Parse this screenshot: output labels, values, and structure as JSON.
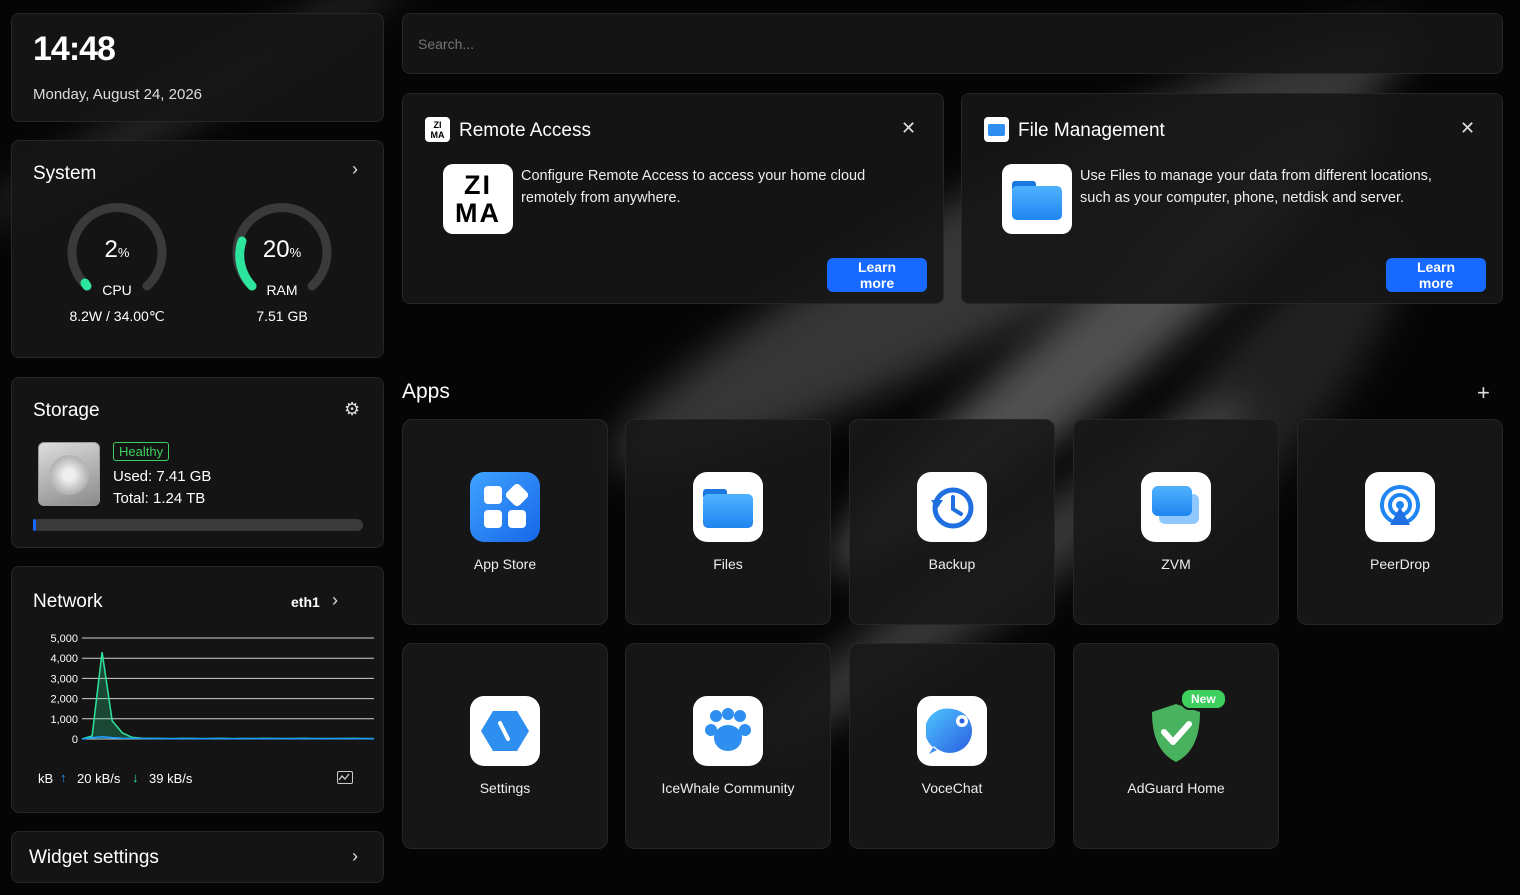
{
  "clock": {
    "time": "14:48",
    "date": "Monday, August 24, 2026"
  },
  "system": {
    "title": "System",
    "cpu": {
      "value": "2",
      "unit": "%",
      "label": "CPU",
      "detail": "8.2W / 34.00℃",
      "percent": 2
    },
    "ram": {
      "value": "20",
      "unit": "%",
      "label": "RAM",
      "detail": "7.51 GB",
      "percent": 20
    }
  },
  "storage": {
    "title": "Storage",
    "status": "Healthy",
    "used": "Used: 7.41 GB",
    "total": "Total: 1.24 TB",
    "used_fraction": 0.006
  },
  "network": {
    "title": "Network",
    "interface": "eth1",
    "unit": "kB",
    "up": "20 kB/s",
    "down": "39 kB/s",
    "chart_data": {
      "type": "area",
      "ylim": [
        0,
        5000
      ],
      "yticks": [
        "5,000",
        "4,000",
        "3,000",
        "2,000",
        "1,000",
        "0"
      ],
      "series": [
        {
          "color": "#2ee59d",
          "values": [
            0,
            150,
            4300,
            900,
            300,
            80,
            40,
            30,
            25,
            20,
            30,
            25,
            20,
            25,
            30,
            20,
            25,
            20,
            30,
            25,
            20,
            25,
            30,
            20,
            25,
            20,
            25,
            30,
            20,
            20
          ]
        },
        {
          "color": "#1e9bff",
          "values": [
            0,
            60,
            120,
            70,
            40,
            30,
            25,
            20,
            20,
            15,
            20,
            20,
            15,
            20,
            20,
            15,
            20,
            20,
            15,
            20,
            20,
            15,
            20,
            20,
            15,
            20,
            20,
            15,
            20,
            15
          ]
        }
      ]
    }
  },
  "widget_settings": {
    "label": "Widget settings"
  },
  "search": {
    "placeholder": "Search..."
  },
  "remote_access": {
    "title": "Remote Access",
    "description": "Configure Remote Access to access your home cloud remotely from anywhere.",
    "button": "Learn more"
  },
  "file_management": {
    "title": "File Management",
    "description": "Use Files to manage your data from different locations, such as your computer, phone, netdisk and server.",
    "button": "Learn more"
  },
  "apps": {
    "title": "Apps",
    "items": [
      {
        "label": "App Store"
      },
      {
        "label": "Files"
      },
      {
        "label": "Backup"
      },
      {
        "label": "ZVM"
      },
      {
        "label": "PeerDrop"
      },
      {
        "label": "Settings"
      },
      {
        "label": "IceWhale Community"
      },
      {
        "label": "VoceChat"
      },
      {
        "label": "AdGuard Home",
        "badge": "New"
      }
    ]
  },
  "colors": {
    "accent": "#1769ff",
    "gauge": "#2ee59d",
    "healthy": "#3ecf5e"
  }
}
